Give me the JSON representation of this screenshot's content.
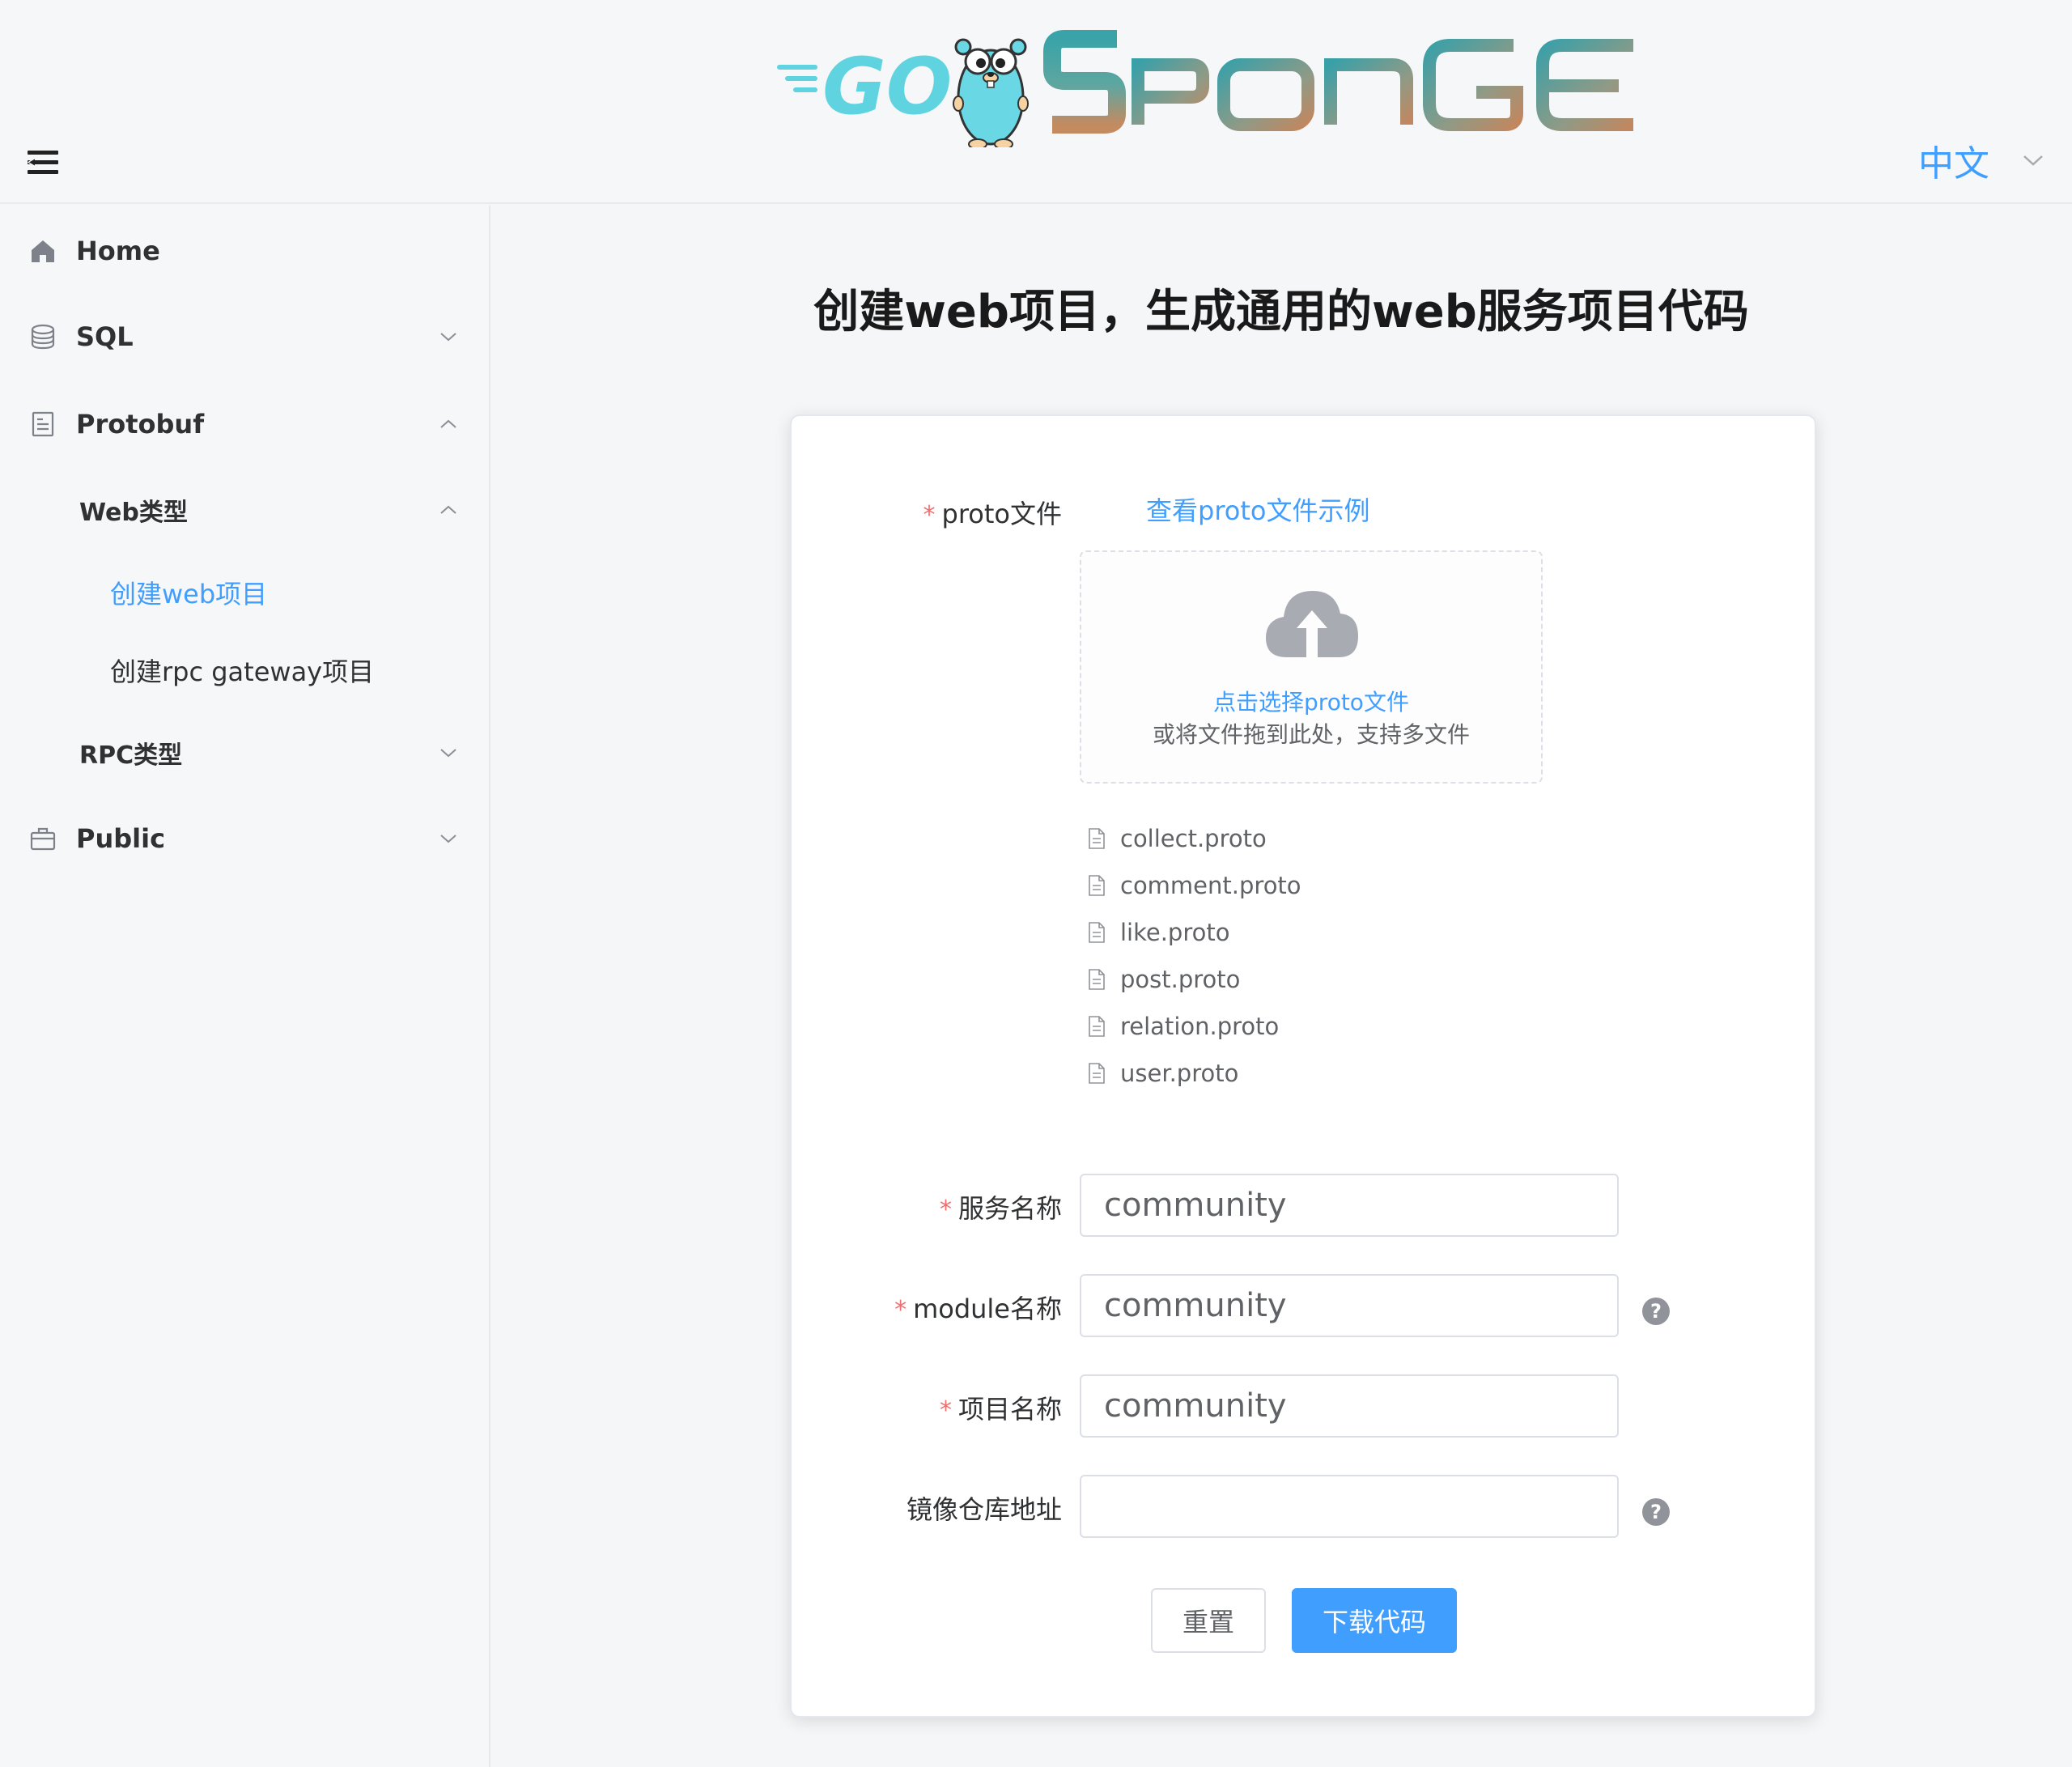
{
  "header": {
    "logo_text": "GO SPONGE",
    "language": "中文"
  },
  "sidebar": {
    "items": [
      {
        "label": "Home",
        "icon": "home-icon"
      },
      {
        "label": "SQL",
        "icon": "database-icon"
      },
      {
        "label": "Protobuf",
        "icon": "document-icon"
      },
      {
        "label": "Web类型"
      },
      {
        "label": "创建web项目"
      },
      {
        "label": "创建rpc gateway项目"
      },
      {
        "label": "RPC类型"
      },
      {
        "label": "Public",
        "icon": "briefcase-icon"
      }
    ]
  },
  "main": {
    "title": "创建web项目，生成通用的web服务项目代码",
    "form": {
      "proto_label": "proto文件",
      "example_link": "查看proto文件示例",
      "upload_primary": "点击选择proto文件",
      "upload_secondary": "或将文件拖到此处，支持多文件",
      "files": [
        "collect.proto",
        "comment.proto",
        "like.proto",
        "post.proto",
        "relation.proto",
        "user.proto"
      ],
      "service_label": "服务名称",
      "service_value": "community",
      "module_label": "module名称",
      "module_value": "community",
      "project_label": "项目名称",
      "project_value": "community",
      "repo_label": "镜像仓库地址",
      "repo_value": "",
      "required_mark": "*",
      "reset_button": "重置",
      "download_button": "下载代码"
    }
  },
  "colors": {
    "accent": "#409eff",
    "required": "#f56c6c"
  }
}
